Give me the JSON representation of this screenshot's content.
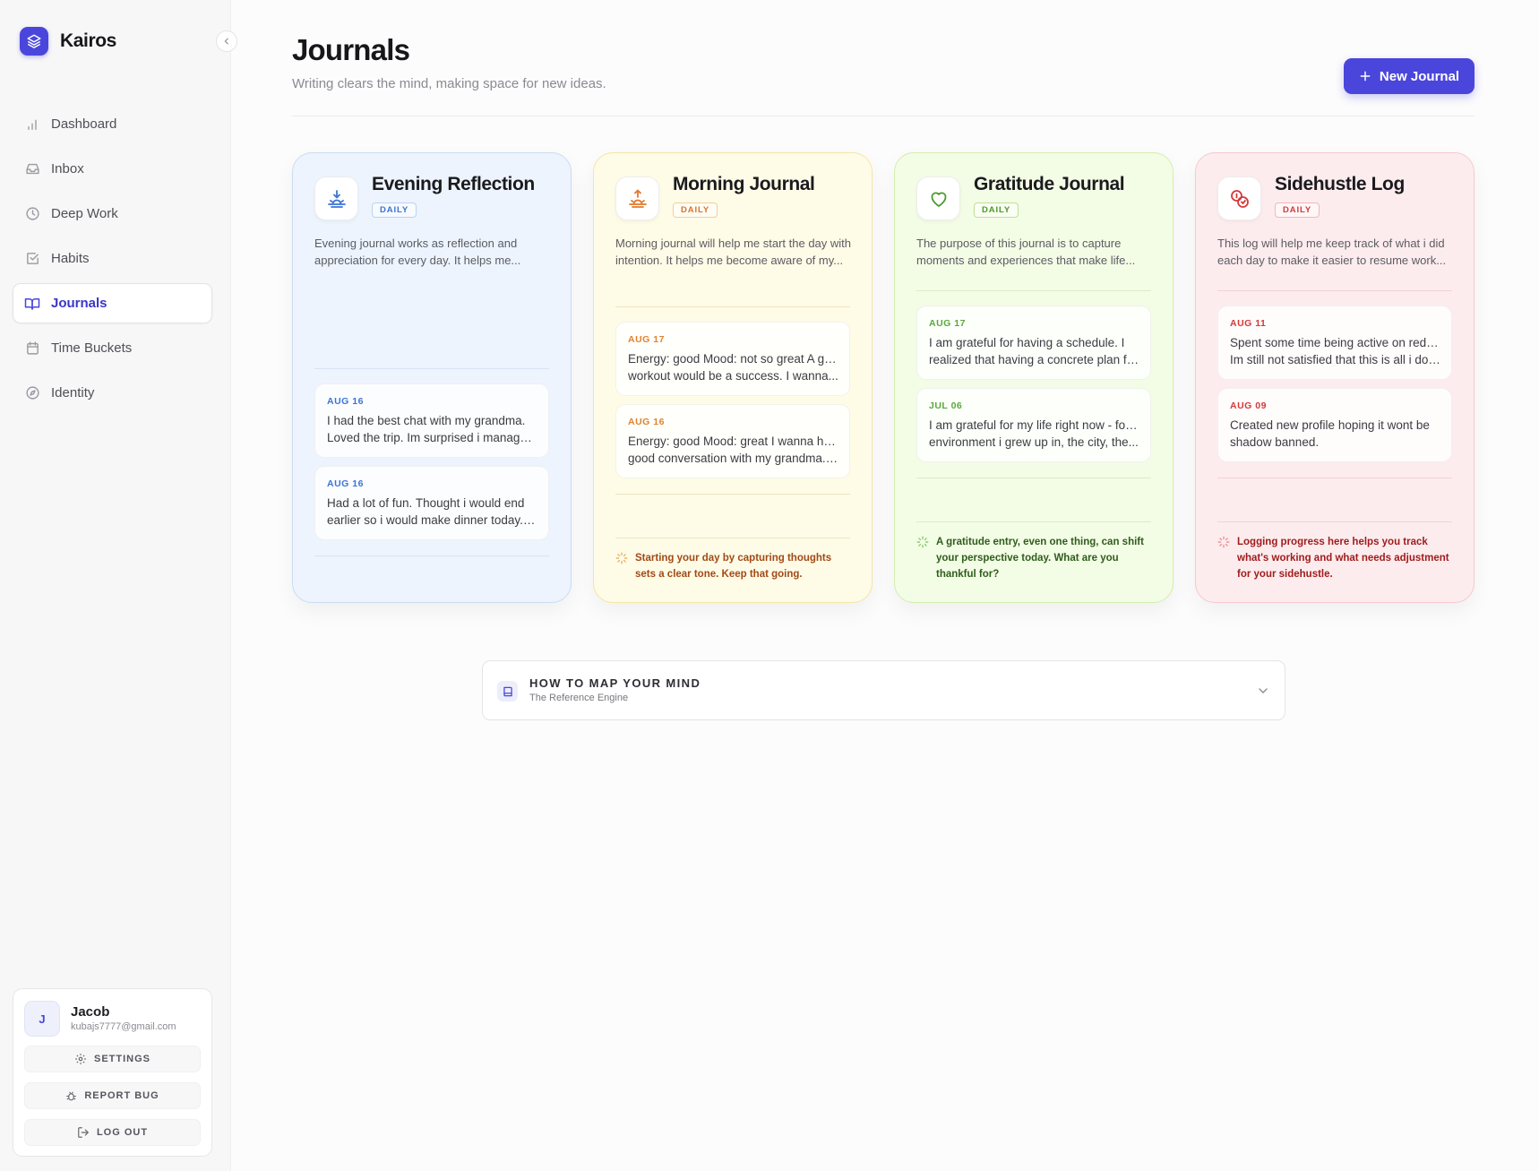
{
  "app": {
    "name": "Kairos"
  },
  "sidebar": {
    "items": [
      {
        "label": "Dashboard",
        "icon": "bar-chart-icon",
        "active": false
      },
      {
        "label": "Inbox",
        "icon": "inbox-icon",
        "active": false
      },
      {
        "label": "Deep Work",
        "icon": "clock-icon",
        "active": false
      },
      {
        "label": "Habits",
        "icon": "checkbox-icon",
        "active": false
      },
      {
        "label": "Journals",
        "icon": "book-open-icon",
        "active": true
      },
      {
        "label": "Time Buckets",
        "icon": "calendar-icon",
        "active": false
      },
      {
        "label": "Identity",
        "icon": "compass-icon",
        "active": false
      }
    ]
  },
  "user": {
    "initial": "J",
    "name": "Jacob",
    "email": "kubajs7777@gmail.com",
    "settings_label": "SETTINGS",
    "report_label": "REPORT BUG",
    "logout_label": "LOG OUT"
  },
  "header": {
    "title": "Journals",
    "subtitle": "Writing clears the mind, making space for new ideas.",
    "new_button": "New Journal"
  },
  "colors": {
    "accent": "#4a46dc"
  },
  "journals": [
    {
      "title": "Evening Reflection",
      "badge": "DAILY",
      "icon": "sunset-icon",
      "description": [
        "Evening journal works as reflection and",
        "appreciation for every day. It helps me..."
      ],
      "entries": [
        {
          "date": "AUG 16",
          "lines": [
            "I had the best chat with my grandma.",
            "Loved the trip. Im surprised i managed t..."
          ]
        },
        {
          "date": "AUG 16",
          "lines": [
            "Had a lot of fun. Thought i would end",
            "earlier so i would make dinner today. I..."
          ]
        }
      ],
      "tip": ""
    },
    {
      "title": "Morning Journal",
      "badge": "DAILY",
      "icon": "sunrise-icon",
      "description": [
        "Morning journal will help me start the day with",
        "intention. It helps me become aware of my..."
      ],
      "entries": [
        {
          "date": "AUG 17",
          "lines": [
            "Energy: good Mood: not so great A good",
            "workout would be a success. I wanna..."
          ]
        },
        {
          "date": "AUG 16",
          "lines": [
            "Energy: good Mood: great I wanna have a",
            "good conversation with my grandma. I..."
          ]
        }
      ],
      "tip": "Starting your day by capturing thoughts sets a clear tone. Keep that going."
    },
    {
      "title": "Gratitude Journal",
      "badge": "DAILY",
      "icon": "heart-icon",
      "description": [
        "The purpose of this journal is to capture",
        "moments and experiences that make life..."
      ],
      "entries": [
        {
          "date": "AUG 17",
          "lines": [
            "I am grateful for having a schedule. I",
            "realized that having a concrete plan for..."
          ]
        },
        {
          "date": "JUL 06",
          "lines": [
            "I am grateful for my life right now - for the",
            "environment i grew up in, the city, the..."
          ]
        }
      ],
      "tip": "A gratitude entry, even one thing, can shift your perspective today. What are you thankful for?"
    },
    {
      "title": "Sidehustle Log",
      "badge": "DAILY",
      "icon": "coins-icon",
      "description": [
        "This log will help me keep track of what i did",
        "each day to make it easier to resume work..."
      ],
      "entries": [
        {
          "date": "AUG 11",
          "lines": [
            "Spent some time being active on reddit.",
            "Im still not satisfied that this is all i do but ..."
          ]
        },
        {
          "date": "AUG 09",
          "lines": [
            "Created new profile hoping it wont be",
            "shadow banned."
          ]
        }
      ],
      "tip": "Logging progress here helps you track what's working and what needs adjustment for your sidehustle."
    }
  ],
  "accordion": {
    "title": "HOW TO MAP YOUR MIND",
    "subtitle": "The Reference Engine"
  }
}
